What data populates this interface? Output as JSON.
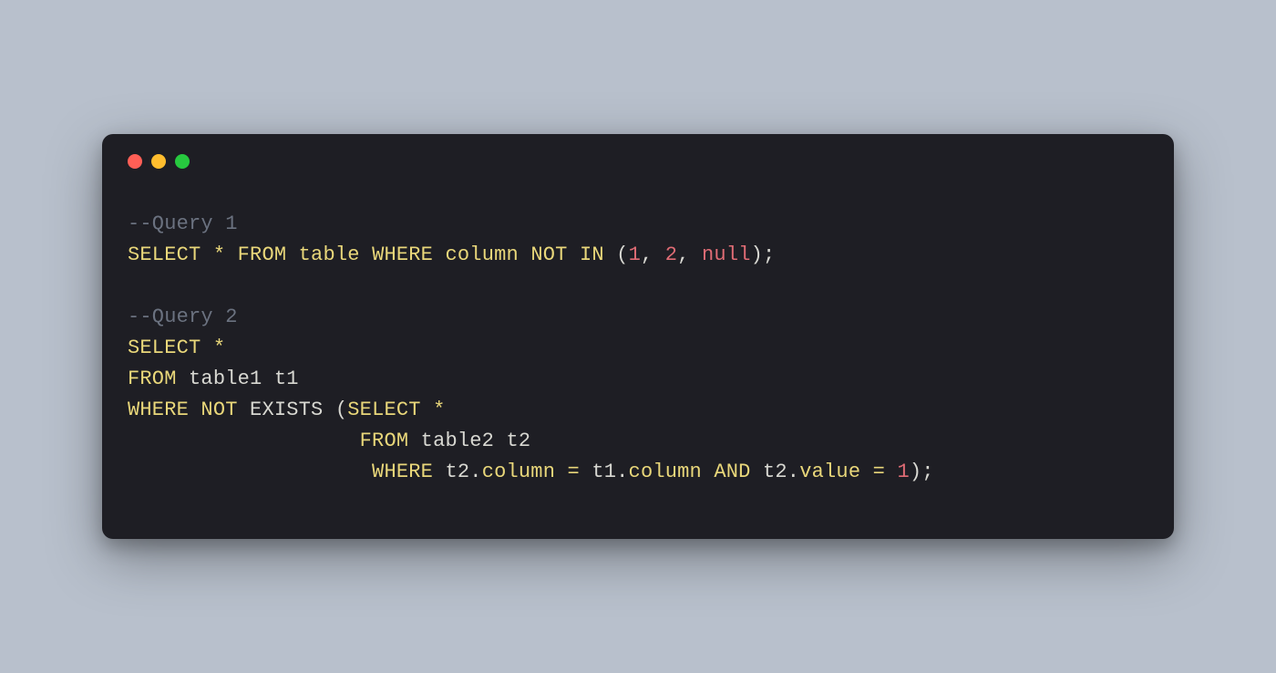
{
  "window": {
    "buttons": [
      "close",
      "minimize",
      "zoom"
    ]
  },
  "code": {
    "lines": [
      [
        {
          "cls": "tok-comment",
          "text": "--Query 1"
        }
      ],
      [
        {
          "cls": "tok-keyword",
          "text": "SELECT"
        },
        {
          "cls": "tok-punc",
          "text": " "
        },
        {
          "cls": "tok-op",
          "text": "*"
        },
        {
          "cls": "tok-punc",
          "text": " "
        },
        {
          "cls": "tok-keyword",
          "text": "FROM"
        },
        {
          "cls": "tok-punc",
          "text": " "
        },
        {
          "cls": "tok-keyword",
          "text": "table"
        },
        {
          "cls": "tok-punc",
          "text": " "
        },
        {
          "cls": "tok-keyword",
          "text": "WHERE"
        },
        {
          "cls": "tok-punc",
          "text": " "
        },
        {
          "cls": "tok-keyword",
          "text": "column"
        },
        {
          "cls": "tok-punc",
          "text": " "
        },
        {
          "cls": "tok-keyword",
          "text": "NOT"
        },
        {
          "cls": "tok-punc",
          "text": " "
        },
        {
          "cls": "tok-keyword",
          "text": "IN"
        },
        {
          "cls": "tok-punc",
          "text": " ("
        },
        {
          "cls": "tok-num",
          "text": "1"
        },
        {
          "cls": "tok-punc",
          "text": ", "
        },
        {
          "cls": "tok-num",
          "text": "2"
        },
        {
          "cls": "tok-punc",
          "text": ", "
        },
        {
          "cls": "tok-null",
          "text": "null"
        },
        {
          "cls": "tok-punc",
          "text": ");"
        }
      ],
      [
        {
          "cls": "tok-punc",
          "text": ""
        }
      ],
      [
        {
          "cls": "tok-comment",
          "text": "--Query 2"
        }
      ],
      [
        {
          "cls": "tok-keyword",
          "text": "SELECT"
        },
        {
          "cls": "tok-punc",
          "text": " "
        },
        {
          "cls": "tok-op",
          "text": "*"
        }
      ],
      [
        {
          "cls": "tok-keyword",
          "text": "FROM"
        },
        {
          "cls": "tok-punc",
          "text": " "
        },
        {
          "cls": "tok-ident",
          "text": "table1 t1"
        }
      ],
      [
        {
          "cls": "tok-keyword",
          "text": "WHERE"
        },
        {
          "cls": "tok-punc",
          "text": " "
        },
        {
          "cls": "tok-keyword",
          "text": "NOT"
        },
        {
          "cls": "tok-punc",
          "text": " "
        },
        {
          "cls": "tok-ident",
          "text": "EXISTS"
        },
        {
          "cls": "tok-punc",
          "text": " ("
        },
        {
          "cls": "tok-keyword",
          "text": "SELECT"
        },
        {
          "cls": "tok-punc",
          "text": " "
        },
        {
          "cls": "tok-op",
          "text": "*"
        }
      ],
      [
        {
          "cls": "tok-punc",
          "text": "                   "
        },
        {
          "cls": "tok-keyword",
          "text": "FROM"
        },
        {
          "cls": "tok-punc",
          "text": " "
        },
        {
          "cls": "tok-ident",
          "text": "table2 t2"
        }
      ],
      [
        {
          "cls": "tok-punc",
          "text": "                    "
        },
        {
          "cls": "tok-keyword",
          "text": "WHERE"
        },
        {
          "cls": "tok-punc",
          "text": " "
        },
        {
          "cls": "tok-ident",
          "text": "t2."
        },
        {
          "cls": "tok-keyword",
          "text": "column"
        },
        {
          "cls": "tok-punc",
          "text": " "
        },
        {
          "cls": "tok-op",
          "text": "="
        },
        {
          "cls": "tok-punc",
          "text": " "
        },
        {
          "cls": "tok-ident",
          "text": "t1."
        },
        {
          "cls": "tok-keyword",
          "text": "column"
        },
        {
          "cls": "tok-punc",
          "text": " "
        },
        {
          "cls": "tok-keyword",
          "text": "AND"
        },
        {
          "cls": "tok-punc",
          "text": " "
        },
        {
          "cls": "tok-ident",
          "text": "t2."
        },
        {
          "cls": "tok-keyword",
          "text": "value"
        },
        {
          "cls": "tok-punc",
          "text": " "
        },
        {
          "cls": "tok-op",
          "text": "="
        },
        {
          "cls": "tok-punc",
          "text": " "
        },
        {
          "cls": "tok-num",
          "text": "1"
        },
        {
          "cls": "tok-punc",
          "text": ");"
        }
      ]
    ]
  }
}
